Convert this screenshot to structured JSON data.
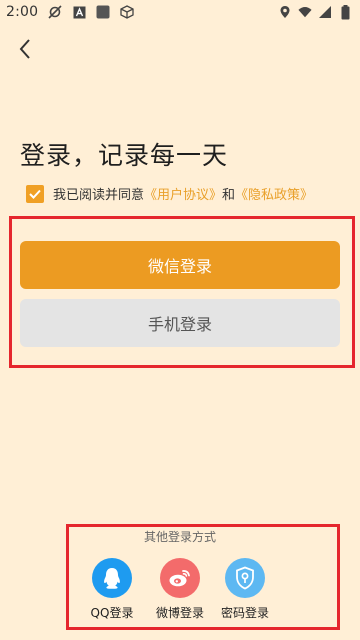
{
  "status_bar": {
    "time": "2:00"
  },
  "headline": "登录，记录每一天",
  "agreement": {
    "checked": true,
    "prefix": "我已阅读并同意",
    "user_agreement": "《用户协议》",
    "conjunction": "和",
    "privacy_policy": "《隐私政策》"
  },
  "buttons": {
    "wechat_login": "微信登录",
    "phone_login": "手机登录"
  },
  "other_methods": {
    "title": "其他登录方式",
    "items": [
      {
        "label": "QQ登录",
        "icon": "qq-icon",
        "color": "#1E9BF0"
      },
      {
        "label": "微博登录",
        "icon": "weibo-icon",
        "color": "#F36B6B"
      },
      {
        "label": "密码登录",
        "icon": "lock-icon",
        "color": "#5DB8F2"
      }
    ]
  },
  "colors": {
    "background": "#FFEFD6",
    "accent": "#EC9B22",
    "link": "#E9A02A",
    "secondary_button": "#E4E4E4",
    "highlight_box": "#E5262D"
  }
}
